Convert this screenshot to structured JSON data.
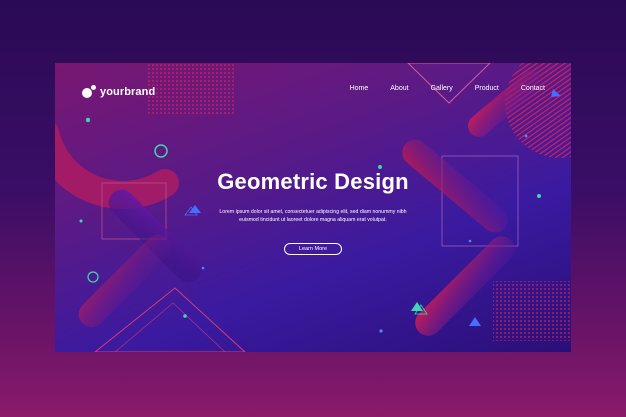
{
  "brand": {
    "name": "yourbrand"
  },
  "nav": {
    "items": [
      {
        "label": "Home"
      },
      {
        "label": "About"
      },
      {
        "label": "Gallery"
      },
      {
        "label": "Product"
      },
      {
        "label": "Contact"
      }
    ]
  },
  "hero": {
    "title": "Geometric Design",
    "subtitle": "Lorem ipsum dolor sit amet, consectetuer adipiscing elit, sed diam nonummy nibh euismod tincidunt ut laoreet dolore magna aliquam erat volutpat.",
    "cta_label": "Learn More"
  },
  "colors": {
    "accent_red": "#d81e4a",
    "accent_teal": "#3fd6b0",
    "accent_blue": "#4a6cff",
    "card_purple": "#4a1a98"
  }
}
